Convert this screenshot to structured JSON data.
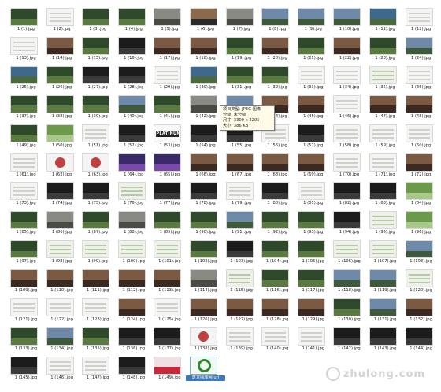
{
  "files": [
    {
      "label": "1 (1).jpg",
      "kind": "forest"
    },
    {
      "label": "1 (2).jpg",
      "kind": "doc"
    },
    {
      "label": "1 (3).jpg",
      "kind": "forest"
    },
    {
      "label": "1 (4).jpg",
      "kind": "forest"
    },
    {
      "label": "1 (5).jpg",
      "kind": "gray"
    },
    {
      "label": "1 (6).jpg",
      "kind": "sunset"
    },
    {
      "label": "1 (7).jpg",
      "kind": "gray"
    },
    {
      "label": "1 (8).jpg",
      "kind": "sky"
    },
    {
      "label": "1 (9).jpg",
      "kind": "sky"
    },
    {
      "label": "1 (10).jpg",
      "kind": "sky"
    },
    {
      "label": "1 (11).jpg",
      "kind": "sea"
    },
    {
      "label": "1 (12).jpg",
      "kind": "doc"
    },
    {
      "label": "1 (13).jpg",
      "kind": "doc"
    },
    {
      "label": "1 (14).jpg",
      "kind": "photo"
    },
    {
      "label": "1 (15).jpg",
      "kind": "forest"
    },
    {
      "label": "1 (16).jpg",
      "kind": "dark"
    },
    {
      "label": "1 (17).jpg",
      "kind": "photo"
    },
    {
      "label": "1 (18).jpg",
      "kind": "photo"
    },
    {
      "label": "1 (19).jpg",
      "kind": "forest"
    },
    {
      "label": "1 (20).jpg",
      "kind": "photo"
    },
    {
      "label": "1 (21).jpg",
      "kind": "forest"
    },
    {
      "label": "1 (22).jpg",
      "kind": "photo"
    },
    {
      "label": "1 (23).jpg",
      "kind": "forest"
    },
    {
      "label": "1 (24).jpg",
      "kind": "sky"
    },
    {
      "label": "1 (25).jpg",
      "kind": "sea"
    },
    {
      "label": "1 (26).jpg",
      "kind": "forest"
    },
    {
      "label": "1 (27).jpg",
      "kind": "dark"
    },
    {
      "label": "1 (28).jpg",
      "kind": "dark"
    },
    {
      "label": "1 (29).jpg",
      "kind": "doc"
    },
    {
      "label": "1 (30).jpg",
      "kind": "sea"
    },
    {
      "label": "1 (31).jpg",
      "kind": "forest"
    },
    {
      "label": "1 (32).jpg",
      "kind": "forest"
    },
    {
      "label": "1 (33).jpg",
      "kind": "doc"
    },
    {
      "label": "1 (34).jpg",
      "kind": "doc"
    },
    {
      "label": "1 (35).jpg",
      "kind": "map"
    },
    {
      "label": "1 (36).jpg",
      "kind": "doc"
    },
    {
      "label": "1 (37).jpg",
      "kind": "forest"
    },
    {
      "label": "1 (38).jpg",
      "kind": "forest"
    },
    {
      "label": "1 (39).jpg",
      "kind": "forest"
    },
    {
      "label": "1 (40).jpg",
      "kind": "sky"
    },
    {
      "label": "1 (41).jpg",
      "kind": "forest"
    },
    {
      "label": "1 (42).jpg",
      "kind": "gray"
    },
    {
      "label": "1 (43).jpg",
      "kind": "sky"
    },
    {
      "label": "1 (44).jpg",
      "kind": "photo"
    },
    {
      "label": "1 (45).jpg",
      "kind": "photo"
    },
    {
      "label": "1 (46).jpg",
      "kind": "doc"
    },
    {
      "label": "1 (47).jpg",
      "kind": "photo"
    },
    {
      "label": "1 (48).jpg",
      "kind": "photo"
    },
    {
      "label": "1 (49).jpg",
      "kind": "forest"
    },
    {
      "label": "1 (50).jpg",
      "kind": "green"
    },
    {
      "label": "1 (51).jpg",
      "kind": "doc"
    },
    {
      "label": "1 (52).jpg",
      "kind": "dark"
    },
    {
      "label": "1 (53).jpg",
      "kind": "title"
    },
    {
      "label": "1 (54).jpg",
      "kind": "dark"
    },
    {
      "label": "1 (55).jpg",
      "kind": "dark"
    },
    {
      "label": "1 (56).jpg",
      "kind": "doc"
    },
    {
      "label": "1 (57).jpg",
      "kind": "dark"
    },
    {
      "label": "1 (58).jpg",
      "kind": "doc"
    },
    {
      "label": "1 (59).jpg",
      "kind": "doc"
    },
    {
      "label": "1 (60).jpg",
      "kind": "doc"
    },
    {
      "label": "1 (61).jpg",
      "kind": "doc"
    },
    {
      "label": "1 (62).jpg",
      "kind": "chart"
    },
    {
      "label": "1 (63).jpg",
      "kind": "chart"
    },
    {
      "label": "1 (64).jpg",
      "kind": "purple"
    },
    {
      "label": "1 (65).jpg",
      "kind": "purple"
    },
    {
      "label": "1 (66).jpg",
      "kind": "photo"
    },
    {
      "label": "1 (67).jpg",
      "kind": "photo"
    },
    {
      "label": "1 (68).jpg",
      "kind": "photo"
    },
    {
      "label": "1 (69).jpg",
      "kind": "photo"
    },
    {
      "label": "1 (70).jpg",
      "kind": "doc"
    },
    {
      "label": "1 (71).jpg",
      "kind": "doc"
    },
    {
      "label": "1 (72).jpg",
      "kind": "photo"
    },
    {
      "label": "1 (73).jpg",
      "kind": "doc"
    },
    {
      "label": "1 (74).jpg",
      "kind": "dark"
    },
    {
      "label": "1 (75).jpg",
      "kind": "dark"
    },
    {
      "label": "1 (76).jpg",
      "kind": "map"
    },
    {
      "label": "1 (77).jpg",
      "kind": "dark"
    },
    {
      "label": "1 (78).jpg",
      "kind": "dark"
    },
    {
      "label": "1 (79).jpg",
      "kind": "doc"
    },
    {
      "label": "1 (80).jpg",
      "kind": "dark"
    },
    {
      "label": "1 (81).jpg",
      "kind": "doc"
    },
    {
      "label": "1 (82).jpg",
      "kind": "dark"
    },
    {
      "label": "1 (83).jpg",
      "kind": "dark"
    },
    {
      "label": "1 (84).jpg",
      "kind": "green"
    },
    {
      "label": "1 (85).jpg",
      "kind": "forest"
    },
    {
      "label": "1 (86).jpg",
      "kind": "gray"
    },
    {
      "label": "1 (87).jpg",
      "kind": "forest"
    },
    {
      "label": "1 (88).jpg",
      "kind": "gray"
    },
    {
      "label": "1 (89).jpg",
      "kind": "forest"
    },
    {
      "label": "1 (90).jpg",
      "kind": "forest"
    },
    {
      "label": "1 (91).jpg",
      "kind": "sky"
    },
    {
      "label": "1 (92).jpg",
      "kind": "forest"
    },
    {
      "label": "1 (93).jpg",
      "kind": "forest"
    },
    {
      "label": "1 (94).jpg",
      "kind": "dark"
    },
    {
      "label": "1 (95).jpg",
      "kind": "map"
    },
    {
      "label": "1 (96).jpg",
      "kind": "green"
    },
    {
      "label": "1 (97).jpg",
      "kind": "forest"
    },
    {
      "label": "1 (98).jpg",
      "kind": "map"
    },
    {
      "label": "1 (99).jpg",
      "kind": "map"
    },
    {
      "label": "1 (100).jpg",
      "kind": "map"
    },
    {
      "label": "1 (101).jpg",
      "kind": "map"
    },
    {
      "label": "1 (102).jpg",
      "kind": "forest"
    },
    {
      "label": "1 (103).jpg",
      "kind": "dark"
    },
    {
      "label": "1 (104).jpg",
      "kind": "forest"
    },
    {
      "label": "1 (105).jpg",
      "kind": "forest"
    },
    {
      "label": "1 (106).jpg",
      "kind": "map"
    },
    {
      "label": "1 (107).jpg",
      "kind": "map"
    },
    {
      "label": "1 (108).jpg",
      "kind": "sky"
    },
    {
      "label": "1 (109).jpg",
      "kind": "photo"
    },
    {
      "label": "1 (110).jpg",
      "kind": "photo"
    },
    {
      "label": "1 (111).jpg",
      "kind": "photo"
    },
    {
      "label": "1 (112).jpg",
      "kind": "photo"
    },
    {
      "label": "1 (113).jpg",
      "kind": "photo"
    },
    {
      "label": "1 (114).jpg",
      "kind": "gray"
    },
    {
      "label": "1 (115).jpg",
      "kind": "map"
    },
    {
      "label": "1 (116).jpg",
      "kind": "forest"
    },
    {
      "label": "1 (117).jpg",
      "kind": "forest"
    },
    {
      "label": "1 (118).jpg",
      "kind": "sky"
    },
    {
      "label": "1 (119).jpg",
      "kind": "sky"
    },
    {
      "label": "1 (120).jpg",
      "kind": "map"
    },
    {
      "label": "1 (121).jpg",
      "kind": "doc"
    },
    {
      "label": "1 (122).jpg",
      "kind": "doc"
    },
    {
      "label": "1 (123).jpg",
      "kind": "doc"
    },
    {
      "label": "1 (124).jpg",
      "kind": "photo"
    },
    {
      "label": "1 (125).jpg",
      "kind": "doc"
    },
    {
      "label": "1 (126).jpg",
      "kind": "photo"
    },
    {
      "label": "1 (127).jpg",
      "kind": "photo"
    },
    {
      "label": "1 (128).jpg",
      "kind": "photo"
    },
    {
      "label": "1 (129).jpg",
      "kind": "photo"
    },
    {
      "label": "1 (130).jpg",
      "kind": "forest"
    },
    {
      "label": "1 (131).jpg",
      "kind": "sky"
    },
    {
      "label": "1 (132).jpg",
      "kind": "photo"
    },
    {
      "label": "1 (133).jpg",
      "kind": "forest"
    },
    {
      "label": "1 (134).jpg",
      "kind": "sky"
    },
    {
      "label": "1 (135).jpg",
      "kind": "forest"
    },
    {
      "label": "1 (136).jpg",
      "kind": "dark"
    },
    {
      "label": "1 (137).jpg",
      "kind": "dark"
    },
    {
      "label": "1 (138).jpg",
      "kind": "chart"
    },
    {
      "label": "1 (139).jpg",
      "kind": "doc"
    },
    {
      "label": "1 (140).jpg",
      "kind": "doc"
    },
    {
      "label": "1 (141).jpg",
      "kind": "doc"
    },
    {
      "label": "1 (142).jpg",
      "kind": "dark"
    },
    {
      "label": "1 (143).jpg",
      "kind": "dark"
    },
    {
      "label": "1 (144).jpg",
      "kind": "dark"
    },
    {
      "label": "1 (145).jpg",
      "kind": "dark"
    },
    {
      "label": "1 (146).jpg",
      "kind": "doc"
    },
    {
      "label": "1 (147).jpg",
      "kind": "doc"
    },
    {
      "label": "1 (148).jpg",
      "kind": "dark"
    },
    {
      "label": "1 (149).jpg",
      "kind": "pink"
    },
    {
      "label": "筑龙图库网.url",
      "kind": "ie",
      "special": true
    }
  ],
  "tooltip": {
    "lines": [
      "项目类型: JPEG 图像",
      "分级: 未分级",
      "尺寸: 3309 x 2205",
      "大小: 386 KB"
    ]
  },
  "palette": {
    "forest": [
      "#2e4a2a",
      "#5a7a42"
    ],
    "sky": [
      "#6f8aa8",
      "#3e5a3a"
    ],
    "sea": [
      "#3d6a8a",
      "#4a6a3e"
    ],
    "sunset": [
      "#8a6a4a",
      "#2a2a2a"
    ],
    "gray": [
      "#8a8a84",
      "#4a4a44"
    ],
    "dark": [
      "#1c1c1c",
      "#3a3a3a"
    ],
    "doc": [
      "#f4f4f2",
      "#d0d0cc"
    ],
    "photo": [
      "#7a5a42",
      "#3a2a22"
    ],
    "map": [
      "#eef0ea",
      "#b8c8a8"
    ],
    "green": [
      "#6a9a4a",
      "#a8c88a"
    ],
    "chart": [
      "#f4f4f4",
      "#c04040"
    ],
    "purple": [
      "#3a2a6a",
      "#7a4aaa"
    ],
    "title": [
      "#f8f8f8",
      "#202020"
    ],
    "pink": [
      "#f0e0e4",
      "#c8283c"
    ],
    "ie": [
      "#f2f8f2",
      "#2a8a2a"
    ]
  },
  "title_text": "PLATINUM",
  "watermark": "zhulong.com"
}
